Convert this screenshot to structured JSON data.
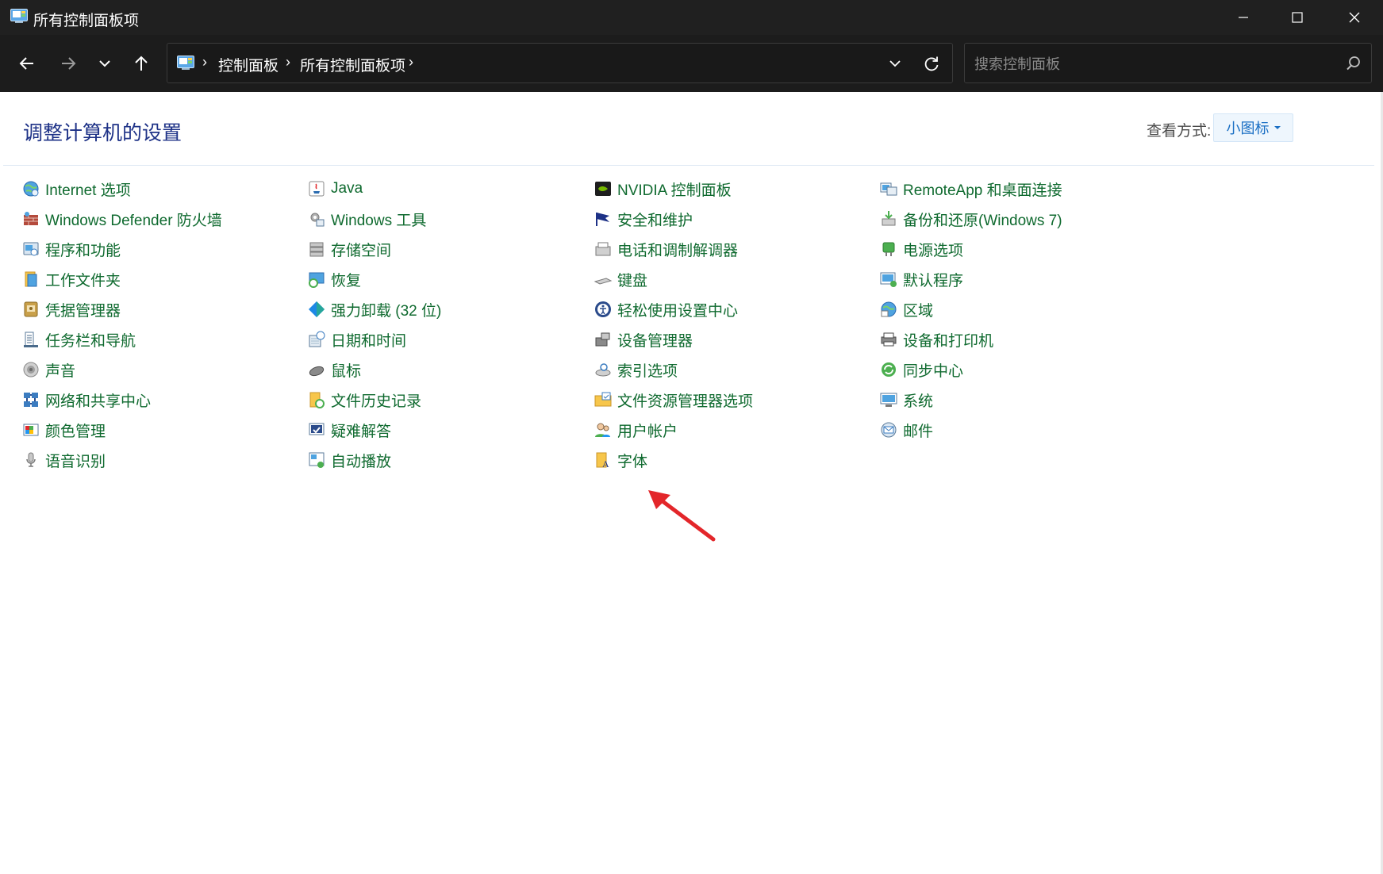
{
  "window": {
    "title": "所有控制面板项"
  },
  "nav": {
    "breadcrumb": [
      "控制面板",
      "所有控制面板项"
    ],
    "search_placeholder": "搜索控制面板"
  },
  "content": {
    "heading": "调整计算机的设置",
    "view_by_label": "查看方式:",
    "view_by_value": "小图标"
  },
  "columns": [
    [
      {
        "label": "Internet 选项",
        "icon": "globe-icon"
      },
      {
        "label": "Windows Defender 防火墙",
        "icon": "firewall-icon"
      },
      {
        "label": "程序和功能",
        "icon": "programs-icon"
      },
      {
        "label": "工作文件夹",
        "icon": "work-folders-icon"
      },
      {
        "label": "凭据管理器",
        "icon": "credential-icon"
      },
      {
        "label": "任务栏和导航",
        "icon": "taskbar-icon"
      },
      {
        "label": "声音",
        "icon": "speaker-icon"
      },
      {
        "label": "网络和共享中心",
        "icon": "network-icon"
      },
      {
        "label": "颜色管理",
        "icon": "color-icon"
      },
      {
        "label": "语音识别",
        "icon": "microphone-icon"
      }
    ],
    [
      {
        "label": "Java",
        "icon": "java-icon"
      },
      {
        "label": "Windows 工具",
        "icon": "tools-icon"
      },
      {
        "label": "存储空间",
        "icon": "storage-icon"
      },
      {
        "label": "恢复",
        "icon": "recovery-icon"
      },
      {
        "label": "强力卸载 (32 位)",
        "icon": "uninstall-icon"
      },
      {
        "label": "日期和时间",
        "icon": "datetime-icon"
      },
      {
        "label": "鼠标",
        "icon": "mouse-icon"
      },
      {
        "label": "文件历史记录",
        "icon": "file-history-icon"
      },
      {
        "label": "疑难解答",
        "icon": "troubleshoot-icon"
      },
      {
        "label": "自动播放",
        "icon": "autoplay-icon"
      }
    ],
    [
      {
        "label": "NVIDIA 控制面板",
        "icon": "nvidia-icon"
      },
      {
        "label": "安全和维护",
        "icon": "flag-icon"
      },
      {
        "label": "电话和调制解调器",
        "icon": "phone-icon"
      },
      {
        "label": "键盘",
        "icon": "keyboard-icon"
      },
      {
        "label": "轻松使用设置中心",
        "icon": "ease-of-access-icon"
      },
      {
        "label": "设备管理器",
        "icon": "device-manager-icon"
      },
      {
        "label": "索引选项",
        "icon": "indexing-icon"
      },
      {
        "label": "文件资源管理器选项",
        "icon": "folder-options-icon"
      },
      {
        "label": "用户帐户",
        "icon": "users-icon"
      },
      {
        "label": "字体",
        "icon": "fonts-icon"
      }
    ],
    [
      {
        "label": "RemoteApp 和桌面连接",
        "icon": "remoteapp-icon"
      },
      {
        "label": "备份和还原(Windows 7)",
        "icon": "backup-icon"
      },
      {
        "label": "电源选项",
        "icon": "power-icon"
      },
      {
        "label": "默认程序",
        "icon": "default-programs-icon"
      },
      {
        "label": "区域",
        "icon": "region-icon"
      },
      {
        "label": "设备和打印机",
        "icon": "printer-icon"
      },
      {
        "label": "同步中心",
        "icon": "sync-icon"
      },
      {
        "label": "系统",
        "icon": "system-icon"
      },
      {
        "label": "邮件",
        "icon": "mail-icon"
      }
    ]
  ],
  "colors": {
    "link_green": "#0f6a2f",
    "heading_blue": "#1e3287",
    "annotation_red": "#e3262a"
  }
}
